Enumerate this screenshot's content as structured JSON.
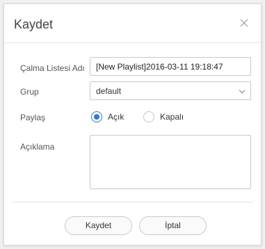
{
  "dialog": {
    "title": "Kaydet"
  },
  "form": {
    "name_label": "Çalma Listesi Adı",
    "name_value": "[New Playlist]2016-03-11 19:18:47",
    "group_label": "Grup",
    "group_value": "default",
    "share_label": "Paylaş",
    "share_options": [
      {
        "label": "Açık",
        "checked": true
      },
      {
        "label": "Kapalı",
        "checked": false
      }
    ],
    "description_label": "Açıklama",
    "description_value": ""
  },
  "buttons": {
    "save_label": "Kaydet",
    "cancel_label": "İptal"
  },
  "colors": {
    "accent": "#2f7bd6"
  },
  "icons": {
    "close": "close-icon",
    "dropdown": "chevron-down-icon"
  }
}
